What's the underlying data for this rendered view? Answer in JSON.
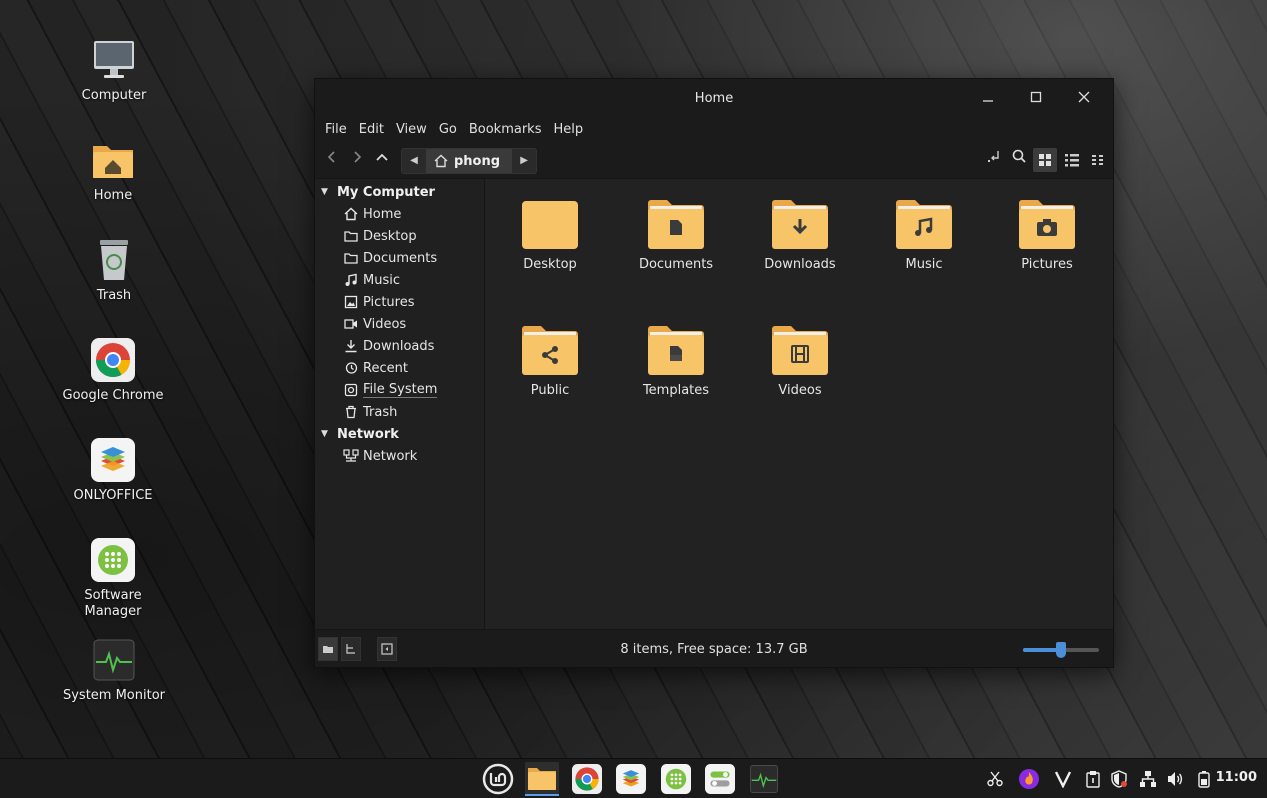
{
  "colors": {
    "folder": "#f8c468",
    "folder_dark": "#e9a94a",
    "accent": "#4a90d9",
    "folder_glyph": "#3b3b3b"
  },
  "desktop": {
    "icons": [
      {
        "label": "Computer",
        "icon": "monitor-icon"
      },
      {
        "label": "Home",
        "icon": "home-folder-icon"
      },
      {
        "label": "Trash",
        "icon": "trash-icon"
      },
      {
        "label": "Google Chrome",
        "icon": "chrome-icon"
      },
      {
        "label": "ONLYOFFICE",
        "icon": "onlyoffice-icon"
      },
      {
        "label": "Software\nManager",
        "icon": "software-manager-icon"
      },
      {
        "label": "System Monitor",
        "icon": "system-monitor-icon"
      }
    ]
  },
  "window": {
    "title": "Home",
    "menu": [
      "File",
      "Edit",
      "View",
      "Go",
      "Bookmarks",
      "Help"
    ],
    "breadcrumb": "phong",
    "sidebar": {
      "sections": [
        {
          "title": "My Computer",
          "items": [
            "Home",
            "Desktop",
            "Documents",
            "Music",
            "Pictures",
            "Videos",
            "Downloads",
            "Recent",
            "File System",
            "Trash"
          ]
        },
        {
          "title": "Network",
          "items": [
            "Network"
          ]
        }
      ]
    },
    "files": [
      {
        "name": "Desktop",
        "glyph": "plain"
      },
      {
        "name": "Documents",
        "glyph": "document"
      },
      {
        "name": "Downloads",
        "glyph": "download"
      },
      {
        "name": "Music",
        "glyph": "music"
      },
      {
        "name": "Pictures",
        "glyph": "camera"
      },
      {
        "name": "Public",
        "glyph": "share"
      },
      {
        "name": "Templates",
        "glyph": "template"
      },
      {
        "name": "Videos",
        "glyph": "film"
      }
    ],
    "status": "8 items, Free space: 13.7 GB",
    "zoom_level": 0.5
  },
  "taskbar": {
    "apps": [
      "mint-menu-icon",
      "files-icon",
      "chrome-icon",
      "onlyoffice-icon",
      "software-manager-icon",
      "settings-icon",
      "system-monitor-icon"
    ],
    "tray": [
      "scissors-icon",
      "flame-icon",
      "v-icon",
      "clipboard-icon",
      "shield-icon",
      "network-icon",
      "volume-icon",
      "battery-icon"
    ],
    "clock": "11:00"
  }
}
